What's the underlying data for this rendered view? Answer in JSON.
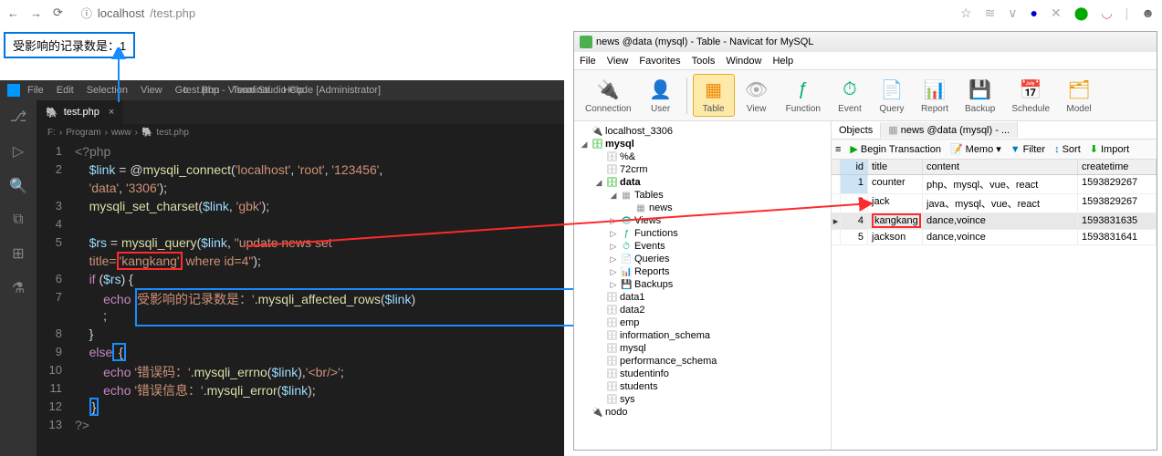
{
  "browser": {
    "url_host": "localhost",
    "url_path": "/test.php",
    "page_output": "受影响的记录数是：1"
  },
  "vscode": {
    "menu": [
      "File",
      "Edit",
      "Selection",
      "View",
      "Go",
      "Run",
      "Terminal",
      "Help"
    ],
    "title": "test.php - Visual Studio Code [Administrator]",
    "tab": "test.php",
    "crumbs": [
      "F:",
      "Program",
      "www",
      "test.php"
    ],
    "lines": {
      "l1_open": "<?php",
      "l2a": "$link",
      "l2b": " = @",
      "l2c": "mysqli_connect",
      "l2d": "(",
      "l2e": "'localhost'",
      "l2f": ", ",
      "l2g": "'root'",
      "l2h": ", ",
      "l2i": "'123456'",
      "l2j": ",",
      "l2k": "'data'",
      "l2l": ", ",
      "l2m": "'3306'",
      "l2n": ");",
      "l3a": "mysqli_set_charset",
      "l3b": "(",
      "l3c": "$link",
      "l3d": ", ",
      "l3e": "'gbk'",
      "l3f": ");",
      "l5a": "$rs",
      "l5b": " = ",
      "l5c": "mysqli_query",
      "l5d": "(",
      "l5e": "$link",
      "l5f": ", ",
      "l5g": "\"update news set ",
      "l5h": "title=",
      "l5i": "'kangkang'",
      "l5j": " where id=4\"",
      "l5k": ");",
      "l6a": "if",
      "l6b": " (",
      "l6c": "$rs",
      "l6d": ") {",
      "l7a": "echo",
      "l7b": " ",
      "l7c": "'受影响的记录数是：'",
      "l7d": ".",
      "l7e": "mysqli_affected_rows",
      "l7f": "(",
      "l7g": "$link",
      "l7h": ")",
      "l7i": ";",
      "l8a": "}",
      "l9a": "else",
      "l9b": " {",
      "l10a": "echo",
      "l10b": " ",
      "l10c": "'错误码：'",
      "l10d": ".",
      "l10e": "mysqli_errno",
      "l10f": "(",
      "l10g": "$link",
      "l10h": "),",
      "l10i": "'<br/>'",
      "l10j": ";",
      "l11a": "echo",
      "l11b": " ",
      "l11c": "'错误信息：'",
      "l11d": ".",
      "l11e": "mysqli_error",
      "l11f": "(",
      "l11g": "$link",
      "l11h": ");",
      "l12a": "}",
      "l13": "?>"
    }
  },
  "navicat": {
    "title": "news @data (mysql) - Table - Navicat for MySQL",
    "menu": [
      "File",
      "View",
      "Favorites",
      "Tools",
      "Window",
      "Help"
    ],
    "tools": [
      "Connection",
      "User",
      "Table",
      "View",
      "Function",
      "Event",
      "Query",
      "Report",
      "Backup",
      "Schedule",
      "Model"
    ],
    "tree": {
      "root": "localhost_3306",
      "db_mysql": "mysql",
      "pct96": "%&",
      "crm": "72crm",
      "data": "data",
      "tables": "Tables",
      "news_table": "news",
      "views": "Views",
      "functions": "Functions",
      "events": "Events",
      "queries": "Queries",
      "reports": "Reports",
      "backups": "Backups",
      "data1": "data1",
      "data2": "data2",
      "emp": "emp",
      "info_schema": "information_schema",
      "db_mysql2": "mysql",
      "perf_schema": "performance_schema",
      "studentinfo": "studentinfo",
      "students": "students",
      "sys": "sys",
      "nodo": "nodo"
    },
    "tabs": {
      "objects": "Objects",
      "news": "news @data (mysql) - ..."
    },
    "tabletools": {
      "begin": "Begin Transaction",
      "memo": "Memo",
      "filter": "Filter",
      "sort": "Sort",
      "import": "Import"
    },
    "columns": {
      "id": "id",
      "title": "title",
      "content": "content",
      "createtime": "createtime"
    },
    "rows": [
      {
        "id": "1",
        "title": "counter",
        "content": "php、mysql、vue、react",
        "createtime": "1593829267"
      },
      {
        "id": "2",
        "title": "jack",
        "content": "java、mysql、vue、react",
        "createtime": "1593829267"
      },
      {
        "id": "4",
        "title": "kangkang",
        "content": "dance,voince",
        "createtime": "1593831635"
      },
      {
        "id": "5",
        "title": "jackson",
        "content": "dance,voince",
        "createtime": "1593831641"
      }
    ]
  }
}
